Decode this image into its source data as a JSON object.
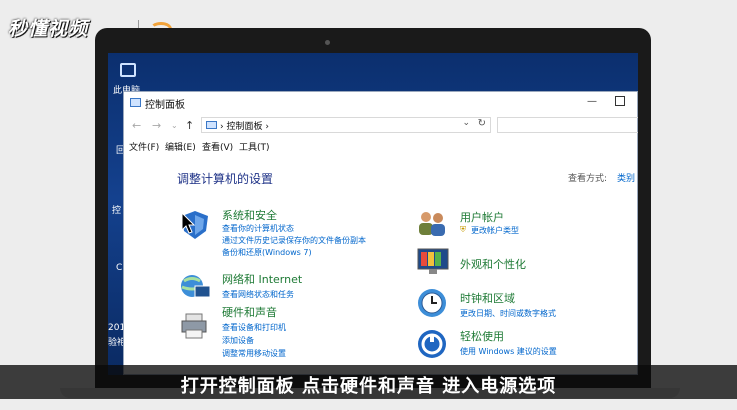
{
  "brand": {
    "name": "秒懂视频"
  },
  "desktop": {
    "icon_label": "此电脑",
    "side_texts": [
      "回",
      "控",
      "C",
      "201",
      "验袍"
    ]
  },
  "window": {
    "title": "控制面板",
    "address": "控制面板",
    "menu": [
      "文件(F)",
      "编辑(E)",
      "查看(V)",
      "工具(T)"
    ],
    "heading": "调整计算机的设置",
    "view_by_label": "查看方式:",
    "view_by_value": "类别",
    "categories": [
      {
        "title": "系统和安全",
        "links": [
          "查看你的计算机状态",
          "通过文件历史记录保存你的文件备份副本",
          "备份和还原(Windows 7)"
        ]
      },
      {
        "title": "网络和 Internet",
        "links": [
          "查看网络状态和任务"
        ]
      },
      {
        "title": "硬件和声音",
        "links": [
          "查看设备和打印机",
          "添加设备",
          "调整常用移动设置"
        ]
      },
      {
        "title": "用户帐户",
        "links": [
          "更改帐户类型"
        ]
      },
      {
        "title": "外观和个性化",
        "links": []
      },
      {
        "title": "时钟和区域",
        "links": [
          "更改日期、时间或数字格式"
        ]
      },
      {
        "title": "轻松使用",
        "links": [
          "使用 Windows 建议的设置"
        ]
      }
    ]
  },
  "subtitle": "打开控制面板 点击硬件和声音 进入电源选项",
  "colors": {
    "accent_link": "#0066cc",
    "category_green": "#1e7a35",
    "heading_blue": "#1e3287"
  }
}
